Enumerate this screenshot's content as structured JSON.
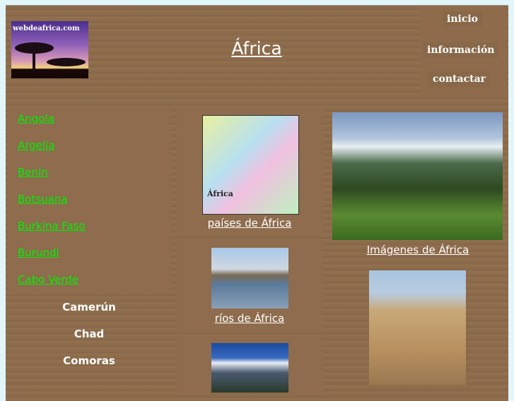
{
  "header": {
    "logo_text": "webdeafrica.com",
    "title": "África"
  },
  "nav": [
    {
      "label": "inicio"
    },
    {
      "label": "información"
    },
    {
      "label": "contactar"
    }
  ],
  "countries_links": [
    "Angola",
    "Argelia",
    "Benín",
    "Botsuana",
    "Burkina Faso",
    "Burundi",
    "Cabo Verde"
  ],
  "countries_plain": [
    "Camerún",
    "Chad",
    "Comoras"
  ],
  "gallery": {
    "map_caption": "países de África",
    "map_label": "África",
    "rivers_caption": "ríos de África",
    "images_caption": "Imágenes de África"
  }
}
